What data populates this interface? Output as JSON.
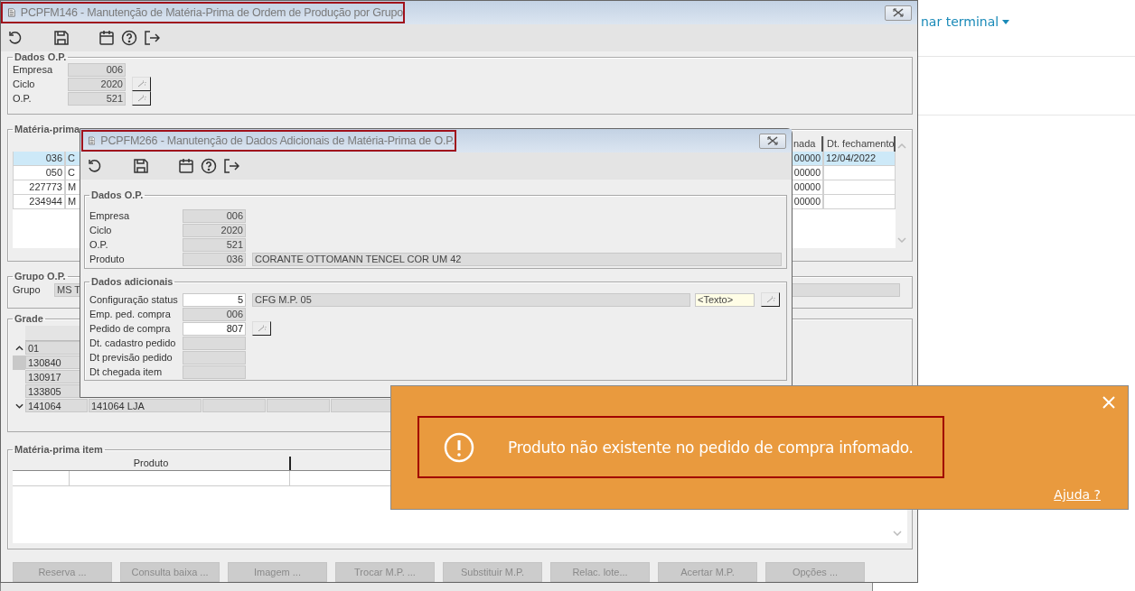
{
  "background": {
    "menu_link": "nar terminal"
  },
  "main_window": {
    "title": "PCPFM146 - Manutenção de Matéria-Prima de Ordem de Produção por Grupo",
    "dados_op": {
      "title": "Dados O.P.",
      "fields": [
        {
          "label": "Empresa",
          "value": "006",
          "lookup": false
        },
        {
          "label": "Ciclo",
          "value": "2020",
          "lookup": true
        },
        {
          "label": "O.P.",
          "value": "521",
          "lookup": true
        }
      ]
    },
    "materia_prima": {
      "title": "Matéria-prima",
      "columns": [
        "nada",
        "Dt. fechamento"
      ],
      "rows": [
        {
          "code": "036",
          "description": "C",
          "column_3": "00000",
          "closing_date": "12/04/2022",
          "selected": true
        },
        {
          "code": "050",
          "description": "C",
          "column_3": "00000",
          "selected": false
        },
        {
          "code": "227773",
          "description": "M",
          "column_3": "00000",
          "selected": false
        },
        {
          "code": "234944",
          "description": "M",
          "column_3": "00000",
          "selected": false
        }
      ]
    },
    "grupo_op": {
      "title": "Grupo O.P.",
      "label": "Grupo",
      "value": "MS T"
    },
    "grade": {
      "title": "Grade",
      "rows": [
        {
          "cells": [
            "01"
          ],
          "selected": false
        },
        {
          "cells": [
            "130840"
          ],
          "selected": true
        },
        {
          "cells": [
            "130917"
          ],
          "selected": false
        },
        {
          "cells": [
            "133805"
          ],
          "selected": false
        },
        {
          "cells": [
            "141064",
            "141064 LJA"
          ],
          "selected": false
        }
      ]
    },
    "materia_prima_item": {
      "title": "Matéria-prima item",
      "columns": [
        "Produto"
      ]
    },
    "buttons": [
      {
        "label": "Reserva ...",
        "disabled": true
      },
      {
        "label": "Consulta baixa ...",
        "disabled": true
      },
      {
        "label": "Imagem ...",
        "disabled": true
      },
      {
        "label": "Trocar M.P. ...",
        "disabled": true
      },
      {
        "label": "Substituir M.P.",
        "disabled": true
      },
      {
        "label": "Relac. lote...",
        "disabled": true
      },
      {
        "label": "Acertar M.P.",
        "disabled": true
      },
      {
        "label": "Opções ...",
        "disabled": true
      }
    ]
  },
  "dialog": {
    "title": "PCPFM266 - Manutenção de Dados Adicionais de Matéria-Prima de O.P.",
    "dados_op": {
      "title": "Dados O.P.",
      "fields": [
        {
          "label": "Empresa",
          "value": "006",
          "editable": false
        },
        {
          "label": "Ciclo",
          "value": "2020",
          "editable": false
        },
        {
          "label": "O.P.",
          "value": "521",
          "editable": false
        },
        {
          "label": "Produto",
          "value": "036",
          "editable": false,
          "description": "CORANTE OTTOMANN TENCEL COR UM 42"
        }
      ]
    },
    "dados_adicionais": {
      "title": "Dados adicionais",
      "fields": [
        {
          "label": "Configuração status",
          "value": "5",
          "editable": true,
          "description": "CFG M.P. 05",
          "note": "<Texto>",
          "lookup": true
        },
        {
          "label": "Emp. ped. compra",
          "value": "006",
          "editable": false,
          "lookup": false
        },
        {
          "label": "Pedido de compra",
          "value": "807",
          "editable": true,
          "lookup": true
        },
        {
          "label": "Dt. cadastro pedido",
          "editable": false,
          "lookup": false
        },
        {
          "label": "Dt previsão pedido",
          "editable": false,
          "lookup": false
        },
        {
          "label": "Dt chegada item",
          "editable": false,
          "lookup": false
        }
      ]
    }
  },
  "toast": {
    "message": "Produto não existente no pedido de compra infomado.",
    "help_link": "Ajuda ?"
  }
}
